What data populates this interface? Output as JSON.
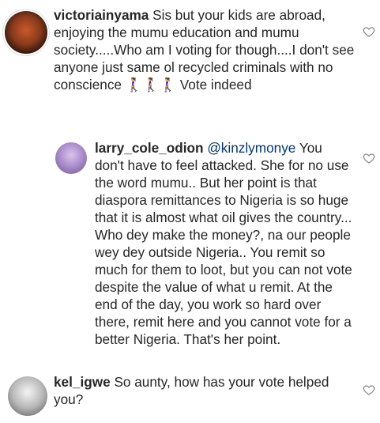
{
  "comments": [
    {
      "username": "victoriainyama",
      "text": "Sis but your kids are abroad, enjoying the mumu education and mumu society.....Who  am I voting for though....I don't see anyone just same ol recycled criminals with no conscience 🚶‍♀️🚶‍♀️🚶‍♀️ Vote indeed",
      "avatar_icon": "profile-photo"
    },
    {
      "username": "larry_cole_odion",
      "mention": "@kinzlymonye",
      "text": "You don't have to feel attacked. She for no use the word mumu.. But her point is that diaspora remittances to Nigeria is so huge that it is almost what oil gives the country... Who dey make the money?, na our people wey dey outside Nigeria.. You remit so much for them to loot, but you can not vote despite the value of what u remit. At the end of the day, you work so hard over there, remit here and you cannot vote for a better Nigeria. That's her point.",
      "avatar_icon": "profile-photo"
    },
    {
      "username": "kel_igwe",
      "text": "So aunty, how has your vote helped you?",
      "avatar_icon": "profile-photo"
    }
  ],
  "like_icon": "heart-outline-icon"
}
